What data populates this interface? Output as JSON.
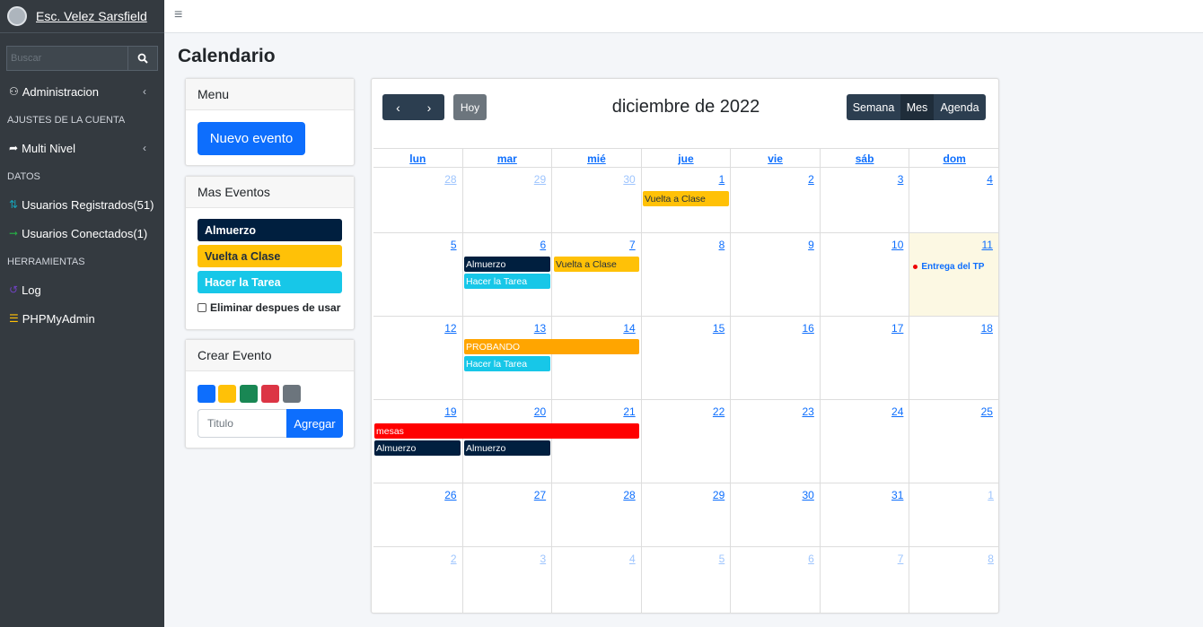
{
  "brand": {
    "name": "Esc. Velez Sarsfield"
  },
  "search": {
    "placeholder": "Buscar"
  },
  "sidebar": {
    "items": [
      {
        "type": "item",
        "label": "Administracion",
        "icon": "users-icon",
        "arrow": true
      },
      {
        "type": "header",
        "label": "AJUSTES DE LA CUENTA"
      },
      {
        "type": "item",
        "label": "Multi Nivel",
        "icon": "share-icon",
        "arrow": true
      },
      {
        "type": "header",
        "label": "DATOS"
      },
      {
        "type": "item",
        "label": "Usuarios Registrados(51)",
        "icon": "sort-icon"
      },
      {
        "type": "item",
        "label": "Usuarios Conectados(1)",
        "icon": "sign-in-icon"
      },
      {
        "type": "header",
        "label": "HERRAMIENTAS"
      },
      {
        "type": "item",
        "label": "Log",
        "icon": "history-icon"
      },
      {
        "type": "item",
        "label": "PHPMyAdmin",
        "icon": "database-icon"
      }
    ]
  },
  "page": {
    "title": "Calendario"
  },
  "menu_card": {
    "header": "Menu",
    "new_event_label": "Nuevo evento"
  },
  "mas_eventos": {
    "header": "Mas Eventos",
    "events": [
      {
        "label": "Almuerzo",
        "color": "#001f3f",
        "text_color": "#ffffff"
      },
      {
        "label": "Vuelta a Clase",
        "color": "#ffc107",
        "text_color": "#1f2d3d"
      },
      {
        "label": "Hacer la Tarea",
        "color": "#17c7e8",
        "text_color": "#ffffff"
      }
    ],
    "checkbox_label": "Eliminar despues de usar"
  },
  "crear_evento": {
    "header": "Crear Evento",
    "colors": [
      "#0d6efd",
      "#ffc107",
      "#198754",
      "#dc3545",
      "#6c757d"
    ],
    "input_placeholder": "Titulo",
    "add_label": "Agregar"
  },
  "calendar": {
    "title": "diciembre de 2022",
    "today_label": "Hoy",
    "prev_icon": "‹",
    "next_icon": "›",
    "views": [
      "Semana",
      "Mes",
      "Agenda"
    ],
    "active_view": "Mes",
    "days_of_week": [
      "lun",
      "mar",
      "mié",
      "jue",
      "vie",
      "sáb",
      "dom"
    ],
    "weeks": [
      [
        "28",
        "29",
        "30",
        "1",
        "2",
        "3",
        "4"
      ],
      [
        "5",
        "6",
        "7",
        "8",
        "9",
        "10",
        "11"
      ],
      [
        "12",
        "13",
        "14",
        "15",
        "16",
        "17",
        "18"
      ],
      [
        "19",
        "20",
        "21",
        "22",
        "23",
        "24",
        "25"
      ],
      [
        "26",
        "27",
        "28",
        "29",
        "30",
        "31",
        "1"
      ],
      [
        "2",
        "3",
        "4",
        "5",
        "6",
        "7",
        "8"
      ]
    ],
    "events": {
      "vuelta_dec1": "Vuelta a Clase",
      "almuerzo_dec6": "Almuerzo",
      "vuelta_dec7": "Vuelta a Clase",
      "tarea_dec6": "Hacer la Tarea",
      "entrega_dec11": "Entrega del TP",
      "probando": "PROBANDO",
      "tarea_dec13": "Hacer la Tarea",
      "mesas": "mesas",
      "almuerzo_dec19": "Almuerzo",
      "almuerzo_dec20": "Almuerzo"
    }
  }
}
